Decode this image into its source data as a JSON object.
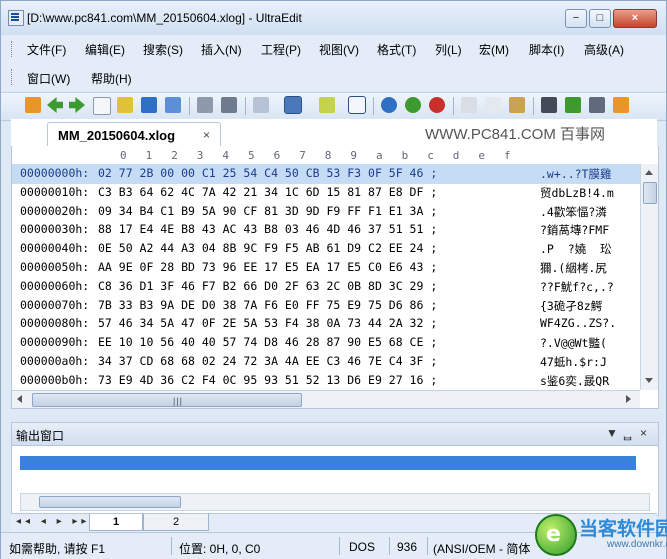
{
  "window": {
    "title": "[D:\\www.pc841.com\\MM_20150604.xlog] - UltraEdit",
    "controls": [
      "−",
      "□",
      "×"
    ]
  },
  "menu": {
    "row1": [
      "文件(F)",
      "编辑(E)",
      "搜索(S)",
      "插入(N)",
      "工程(P)",
      "视图(V)",
      "格式(T)",
      "列(L)",
      "宏(M)",
      "脚本(I)",
      "高级(A)"
    ],
    "row2": [
      "窗口(W)",
      "帮助(H)"
    ]
  },
  "toolbar": {
    "icons": [
      "open-folder-icon",
      "arrow-left-icon",
      "arrow-right-icon",
      "new-file-icon",
      "open-file-icon",
      "save-icon",
      "save-all-icon",
      "print-icon",
      "print-preview-icon",
      "list-icon",
      "hex-mode-icon",
      "column-icon",
      "word-wrap-icon",
      "globe-icon",
      "ftp-icon",
      "web-icon",
      "cut-icon",
      "copy-icon",
      "paste-icon",
      "find-icon",
      "find-next-icon",
      "replace-icon",
      "tools-icon"
    ],
    "colors": {
      "orange": "#e8952a",
      "green": "#3c9a2e",
      "blue": "#2f6fc4",
      "red": "#c9302c",
      "gray": "#8e9aab",
      "yellow": "#e2c13a"
    }
  },
  "tab": {
    "label": "MM_20150604.xlog",
    "close": "×"
  },
  "watermark_top": "WWW.PC841.COM 百事网",
  "editor": {
    "ruler": [
      "0",
      "1",
      "2",
      "3",
      "4",
      "5",
      "6",
      "7",
      "8",
      "9",
      "a",
      "b",
      "c",
      "d",
      "e",
      "f"
    ],
    "rows": [
      {
        "addr": "00000000h:",
        "hex": "02 77 2B 00 00 C1 25 54 C4 50 CB 53 F3 0F 5F 46 ;",
        "text": ".w+..?T膜雞"
      },
      {
        "addr": "00000010h:",
        "hex": "C3 B3 64 62 4C 7A 42 21 34 1C 6D 15 81 87 E8 DF ;",
        "text": "贸dbLzB!4.m"
      },
      {
        "addr": "00000020h:",
        "hex": "09 34 B4 C1 B9 5A 90 CF 81 3D 9D F9 FF F1 E1 3A ;",
        "text": ".4歡笨愊?潾"
      },
      {
        "addr": "00000030h:",
        "hex": "88 17 E4 4E B8 43 AC 43 B8 03 46 4D 46 37 51 51 ;",
        "text": "?銷萵塼?FMF"
      },
      {
        "addr": "00000040h:",
        "hex": "0E 50 A2 44 A3 04 8B 9C F9 F5 AB 61 D9 C2 EE 24 ;",
        "text": ".P  ?嬈  玜"
      },
      {
        "addr": "00000050h:",
        "hex": "AA 9E 0F 28 BD 73 96 EE 17 E5 EA 17 E5 C0 E6 43 ;",
        "text": "獮.(絪栲.尻"
      },
      {
        "addr": "00000060h:",
        "hex": "C8 36 D1 3F 46 F7 B2 66 D0 2F 63 2C 0B 8D 3C 29 ;",
        "text": "??F魷f?c,.?"
      },
      {
        "addr": "00000070h:",
        "hex": "7B 33 B3 9A DE D0 38 7A F6 E0 FF 75 E9 75 D6 86 ;",
        "text": "{3硊孑8z鰐"
      },
      {
        "addr": "00000080h:",
        "hex": "57 46 34 5A 47 0F 2E 5A 53 F4 38 0A 73 44 2A 32 ;",
        "text": "WF4ZG..ZS?."
      },
      {
        "addr": "00000090h:",
        "hex": "EE 10 10 56 40 40 57 74 D8 46 28 87 90 E5 68 CE ;",
        "text": "?.V@@Wt豓("
      },
      {
        "addr": "000000a0h:",
        "hex": "34 37 CD 68 68 02 24 72 3A 4A EE C3 46 7E C4 3F ;",
        "text": "47蚳h.$r:J"
      },
      {
        "addr": "000000b0h:",
        "hex": "73 E9 4D 36 C2 F4 0C 95 93 51 52 13 D6 E9 27 16 ;",
        "text": "s鉴6奕.晸QR"
      }
    ]
  },
  "output_panel": {
    "title": "输出窗口",
    "controls": [
      "▼",
      "ᆸ",
      "×"
    ]
  },
  "sheets": {
    "nav": "◂◂ ◂ ▸ ▸▸",
    "tabs": [
      "1",
      "2"
    ]
  },
  "status": {
    "help": "如需帮助, 请按 F1",
    "position": "位置: 0H, 0, C0",
    "format": "DOS",
    "codepage": "936",
    "encoding": "(ANSI/OEM - 简体"
  },
  "logo": {
    "name": "当客软件园",
    "url": "www.downkr.com"
  }
}
